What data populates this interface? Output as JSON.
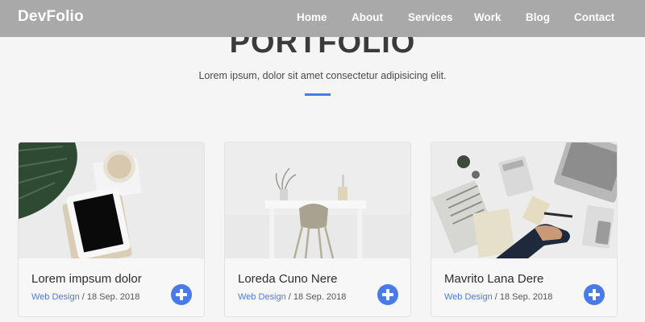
{
  "navbar": {
    "brand": "DevFolio",
    "links": [
      "Home",
      "About",
      "Services",
      "Work",
      "Blog",
      "Contact"
    ]
  },
  "section": {
    "title": "PORTFOLIO",
    "subtitle": "Lorem ipsum, dolor sit amet consectetur adipisicing elit."
  },
  "cards": [
    {
      "title": "Lorem impsum dolor",
      "category": "Web Design",
      "separator": " / ",
      "date": "18 Sep. 2018"
    },
    {
      "title": "Loreda Cuno Nere",
      "category": "Web Design",
      "separator": " / ",
      "date": "18 Sep. 2018"
    },
    {
      "title": "Mavrito Lana Dere",
      "category": "Web Design",
      "separator": " / ",
      "date": "18 Sep. 2018"
    }
  ],
  "colors": {
    "accent": "#4a7ae8",
    "navbar": "#a9a9a9",
    "background": "#f5f5f5"
  }
}
